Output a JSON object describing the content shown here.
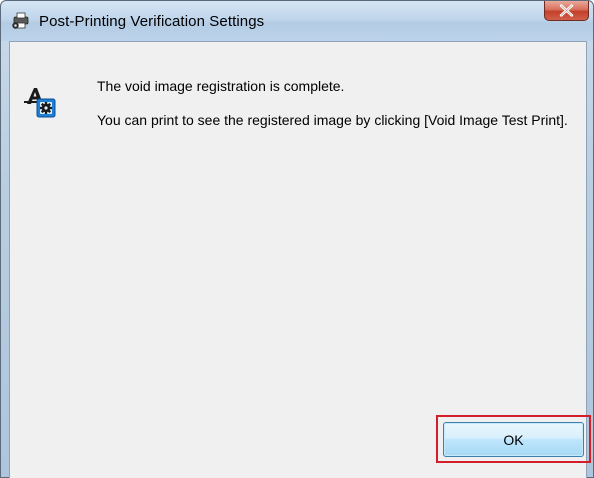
{
  "window": {
    "title": "Post-Printing Verification Settings",
    "title_icon": "printer-gear-icon",
    "close_icon": "close-icon"
  },
  "message": {
    "icon": "void-image-settings-icon",
    "line1": "The void image registration is complete.",
    "line2": "You can print to see the registered image by clicking [Void Image Test Print]."
  },
  "buttons": {
    "ok_label": "OK"
  },
  "colors": {
    "highlight_border": "#d21f2a",
    "client_background": "#f0f0f0",
    "close_button": "#c2402a",
    "ok_button_border": "#3c7fb1"
  }
}
